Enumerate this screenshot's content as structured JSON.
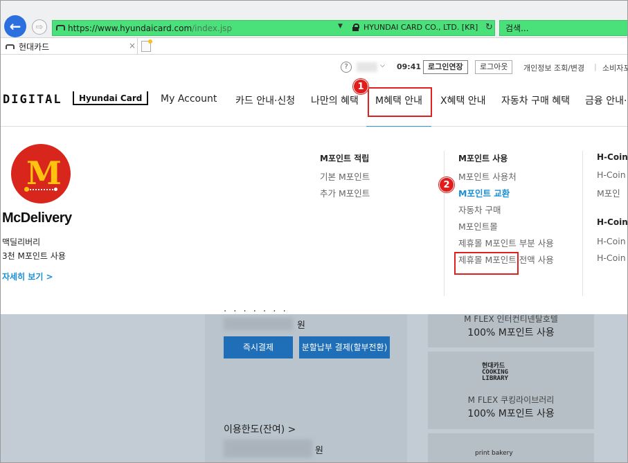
{
  "browser": {
    "url_host": "https://www.hyundaicard.com",
    "url_path": "/index.jsp",
    "cert_label": "HYUNDAI CARD CO., LTD. [KR]",
    "search_placeholder": "검색...",
    "tab_title": "현대카드",
    "tab_close": "×"
  },
  "utility": {
    "help": "?",
    "time": "09:41",
    "extend_login": "로그인연장",
    "logout": "로그아웃",
    "privacy": "개인정보 조회/변경",
    "consumer": "소비자포"
  },
  "brand": {
    "digital": "DIGITAL",
    "hyundai_card": "Hyundai Card"
  },
  "gnb": [
    "My Account",
    "카드 안내·신청",
    "나만의 혜택",
    "M혜택 안내",
    "X혜택 안내",
    "자동차 구매 혜택",
    "금융 안내·"
  ],
  "promo": {
    "title": "McDelivery",
    "line1": "맥딜리버리",
    "line2": "3천 M포인트 사용",
    "link": "자세히 보기 >"
  },
  "mega": {
    "earn": {
      "heading": "M포인트 적립",
      "items": [
        "기본 M포인트",
        "추가 M포인트"
      ]
    },
    "use": {
      "heading": "M포인트 사용",
      "items": [
        "M포인트 사용처",
        "M포인트 교환",
        "자동차 구매",
        "M포인트몰",
        "제휴몰 M포인트 부분 사용",
        "제휴몰 M포인트 전액 사용"
      ]
    },
    "hcoin": {
      "heading1": "H-Coin",
      "items1": [
        "H-Coin",
        "M포인"
      ],
      "heading2": "H-Coin",
      "items2": [
        "H-Coin",
        "H-Coin"
      ]
    }
  },
  "callouts": {
    "one": "1",
    "two": "2"
  },
  "background_page": {
    "won": "원",
    "instant_pay": "즉시결제",
    "installment_pay": "분할납부 결제(할부전환)",
    "limit": "이용한도(잔여) >",
    "card1_sub": "M FLEX 인터컨티넨탈호텔",
    "card1_main": "100% M포인트 사용",
    "card2_logo": "현대카드\nCOOKING\nLIBRARY",
    "card2_sub": "M FLEX 쿠킹라이브러리",
    "card2_main": "100% M포인트 사용",
    "card3_logo": "print bakery"
  },
  "colors": {
    "accent_blue": "#1a8fd6",
    "callout_red": "#e21b1b",
    "url_green": "#4ae07a"
  }
}
